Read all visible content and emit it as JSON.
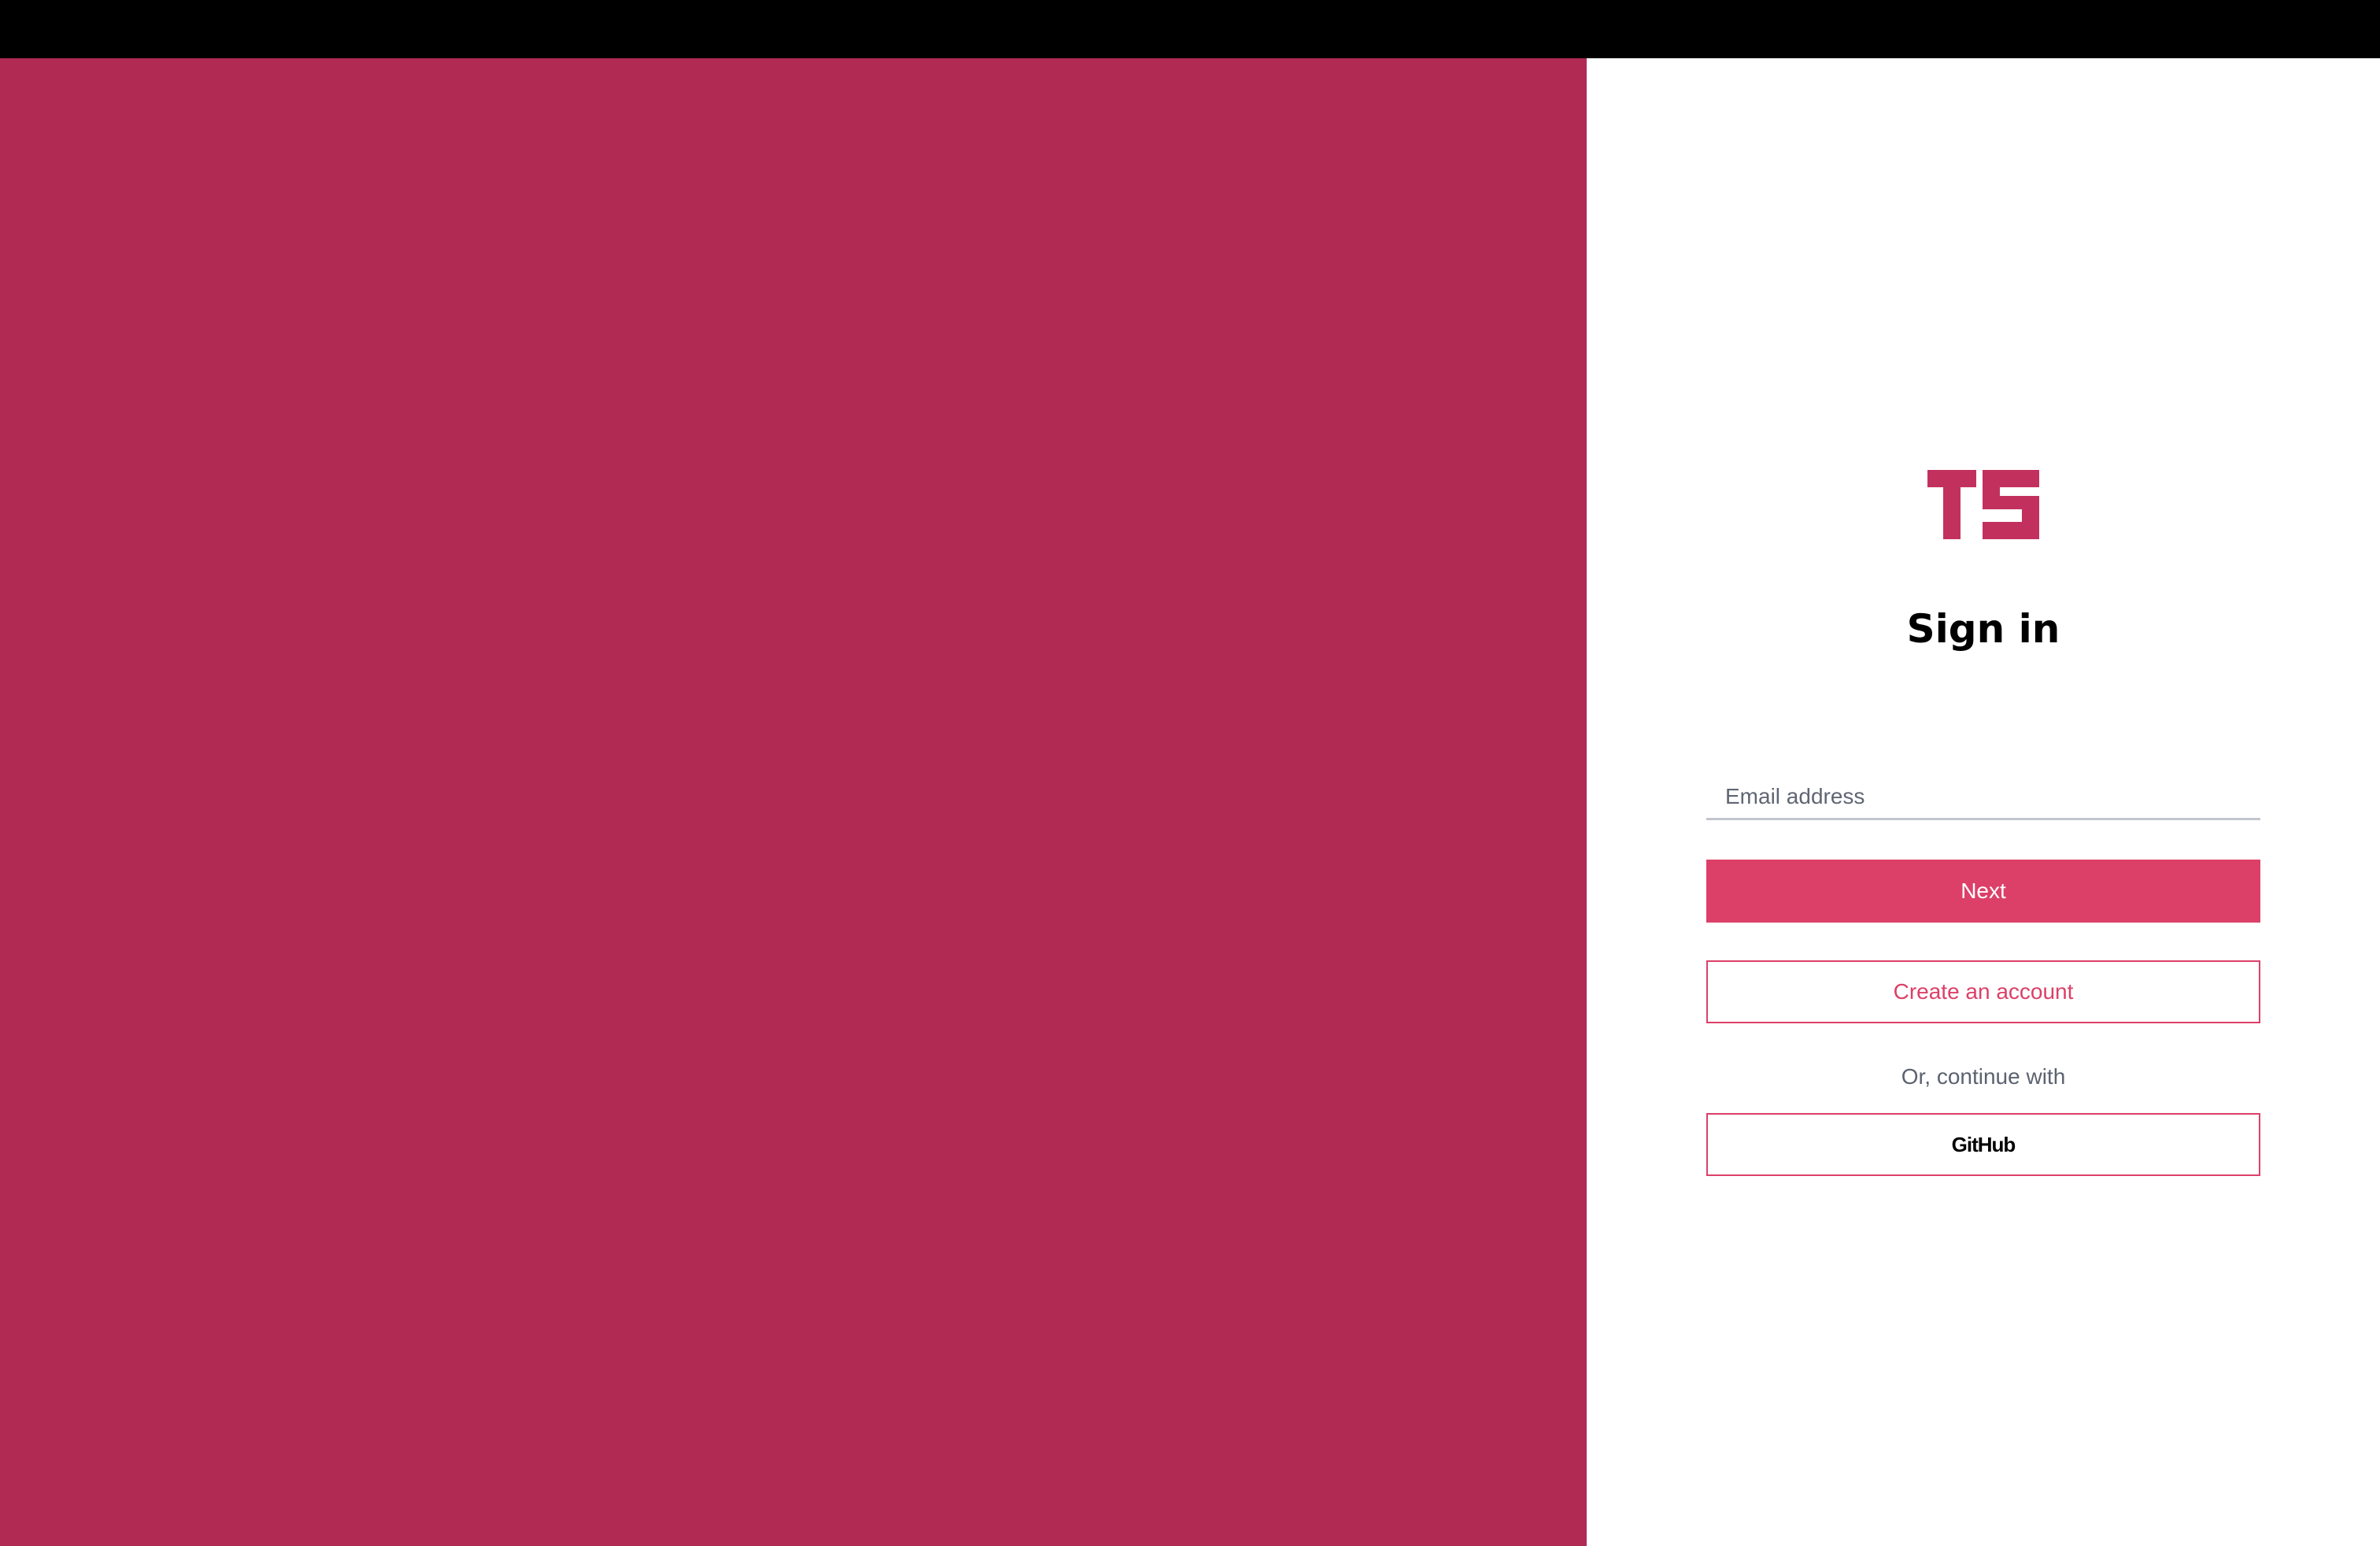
{
  "colors": {
    "top_bar": "#000000",
    "brand_panel": "#b02a53",
    "accent": "#dc4068",
    "logo": "#c2315e",
    "background": "#ffffff"
  },
  "logo": {
    "icon": "ts-logo-icon",
    "text": "TS"
  },
  "signin": {
    "title": "Sign in",
    "email_placeholder": "Email address",
    "email_value": "",
    "next_label": "Next",
    "create_account_label": "Create an account",
    "continue_with_label": "Or, continue with",
    "github_label": "GitHub"
  }
}
